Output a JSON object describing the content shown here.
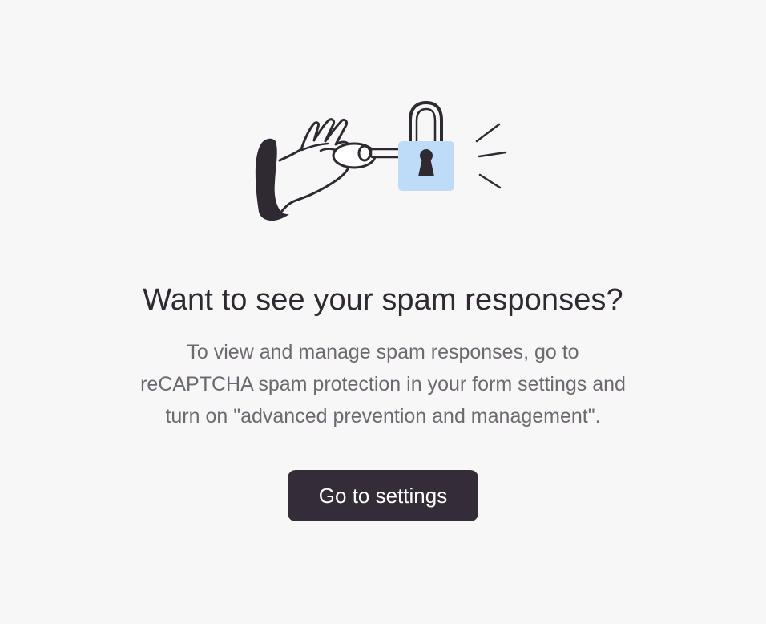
{
  "illustration": {
    "icon": "hand-unlocking-padlock-icon",
    "accent_color": "#bedcf7",
    "line_color": "#2f2932"
  },
  "empty_state": {
    "title": "Want to see your spam responses?",
    "description_lines": [
      "To view and manage spam responses, go to",
      "reCAPTCHA spam protection in your form settings and",
      "turn on \"advanced prevention and management\"."
    ],
    "button_label": "Go to settings"
  },
  "colors": {
    "background": "#f7f7f7",
    "title_text": "#2f2932",
    "description_text": "#6e6970",
    "button_background": "#342c36",
    "button_text": "#ffffff"
  }
}
